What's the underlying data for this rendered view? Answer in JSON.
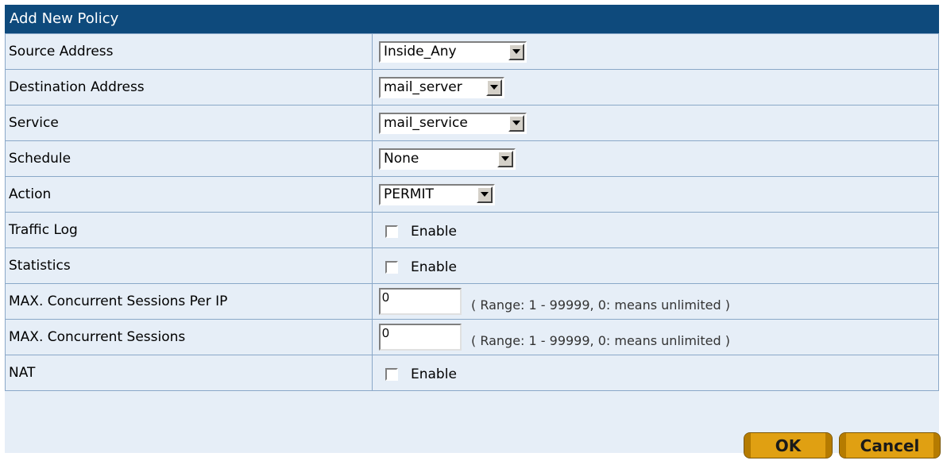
{
  "form": {
    "title": "Add New Policy",
    "rows": {
      "source_address": {
        "label": "Source Address",
        "value": "Inside_Any"
      },
      "destination_address": {
        "label": "Destination Address",
        "value": "mail_server"
      },
      "service": {
        "label": "Service",
        "value": "mail_service"
      },
      "schedule": {
        "label": "Schedule",
        "value": "None"
      },
      "action": {
        "label": "Action",
        "value": "PERMIT"
      },
      "traffic_log": {
        "label": "Traffic Log",
        "option": "Enable",
        "checked": false
      },
      "statistics": {
        "label": "Statistics",
        "option": "Enable",
        "checked": false
      },
      "max_sessions_per_ip": {
        "label": "MAX. Concurrent Sessions Per IP",
        "value": "0",
        "hint": "( Range: 1 - 99999, 0: means unlimited )"
      },
      "max_sessions": {
        "label": "MAX. Concurrent Sessions",
        "value": "0",
        "hint": "( Range: 1 - 99999, 0: means unlimited )"
      },
      "nat": {
        "label": "NAT",
        "option": "Enable",
        "checked": false
      }
    }
  },
  "buttons": {
    "ok": "OK",
    "cancel": "Cancel"
  },
  "colors": {
    "header_bg": "#0e4a7c",
    "row_bg": "#e6eef7",
    "button_bg": "#e0a012"
  }
}
